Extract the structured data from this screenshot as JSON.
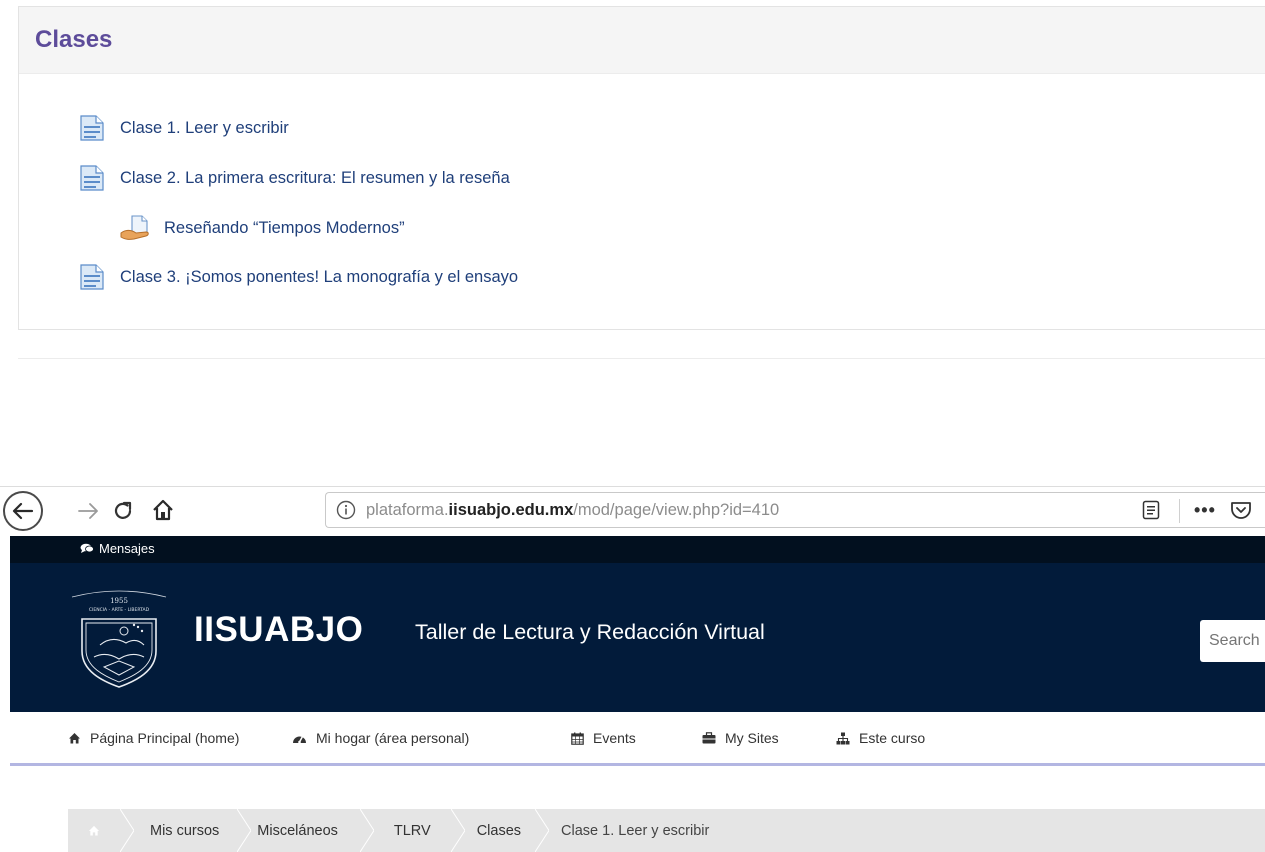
{
  "section": {
    "title": "Clases",
    "activities": [
      {
        "label": "Clase 1. Leer y escribir",
        "type": "page"
      },
      {
        "label": "Clase 2. La primera escritura: El resumen y la reseña",
        "type": "page"
      },
      {
        "label": "Reseñando “Tiempos Modernos”",
        "type": "assignment"
      },
      {
        "label": "Clase 3. ¡Somos ponentes! La monografía y el ensayo",
        "type": "page"
      }
    ]
  },
  "browser": {
    "url_prefix": "plataforma.",
    "url_domain": "iisuabjo.edu.mx",
    "url_path": "/mod/page/view.php?id=410",
    "more_label": "•••"
  },
  "site": {
    "messages_label": "Mensajes",
    "brand": "IISUABJO",
    "tagline": "Taller de Lectura y Redacción Virtual",
    "search_placeholder": "Search",
    "logo_text_top": "1955",
    "logo_text_bottom": "CIENCIA - ARTE - LIBERTAD"
  },
  "nav": {
    "items": [
      {
        "label": "Página Principal (home)",
        "icon": "home-icon"
      },
      {
        "label": "Mi hogar (área personal)",
        "icon": "dashboard-icon"
      },
      {
        "label": "Events",
        "icon": "calendar-icon"
      },
      {
        "label": "My Sites",
        "icon": "briefcase-icon"
      },
      {
        "label": "Este curso",
        "icon": "sitemap-icon"
      }
    ]
  },
  "breadcrumb": {
    "items": [
      "Mis cursos",
      "Misceláneos",
      "TLRV",
      "Clases"
    ],
    "current": "Clase 1. Leer y escribir"
  },
  "colors": {
    "section_title": "#5d4c9a",
    "link": "#1f3f7a",
    "header_bg": "#021b3a",
    "messages_bar_bg": "#02101f",
    "nav_underline": "#b3b6e2",
    "breadcrumb_bg": "#e5e5e5"
  }
}
